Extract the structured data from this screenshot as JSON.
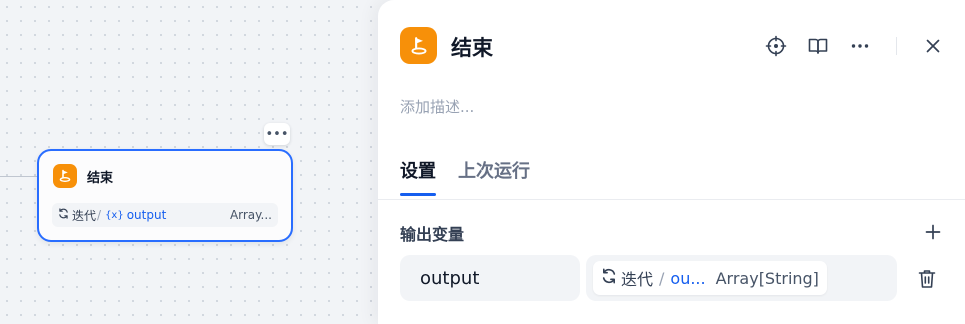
{
  "canvas": {
    "node": {
      "title": "结束",
      "icon": "flag-end-icon",
      "more_label": "•••",
      "variable": {
        "scope_icon": "loop-icon",
        "scope": "迭代",
        "separator": "/",
        "var_icon": "{x}",
        "name": "output",
        "type": "Array..."
      }
    }
  },
  "panel": {
    "title": "结束",
    "icon": "flag-end-icon",
    "toolbar": [
      "locate-icon",
      "book-icon",
      "more-icon",
      "close-icon"
    ],
    "description_placeholder": "添加描述...",
    "tabs": [
      {
        "label": "设置",
        "active": true
      },
      {
        "label": "上次运行",
        "active": false
      }
    ],
    "output_section": {
      "title": "输出变量",
      "add_icon": "plus-icon",
      "variables": [
        {
          "name": "output",
          "ref_scope": "迭代",
          "ref_separator": "/",
          "ref_name": "ou...",
          "ref_type": "Array[String]",
          "delete_icon": "trash-icon"
        }
      ]
    }
  },
  "colors": {
    "accent": "#155eef",
    "node_border": "#296dff",
    "end_icon_bg": "#f79009"
  }
}
